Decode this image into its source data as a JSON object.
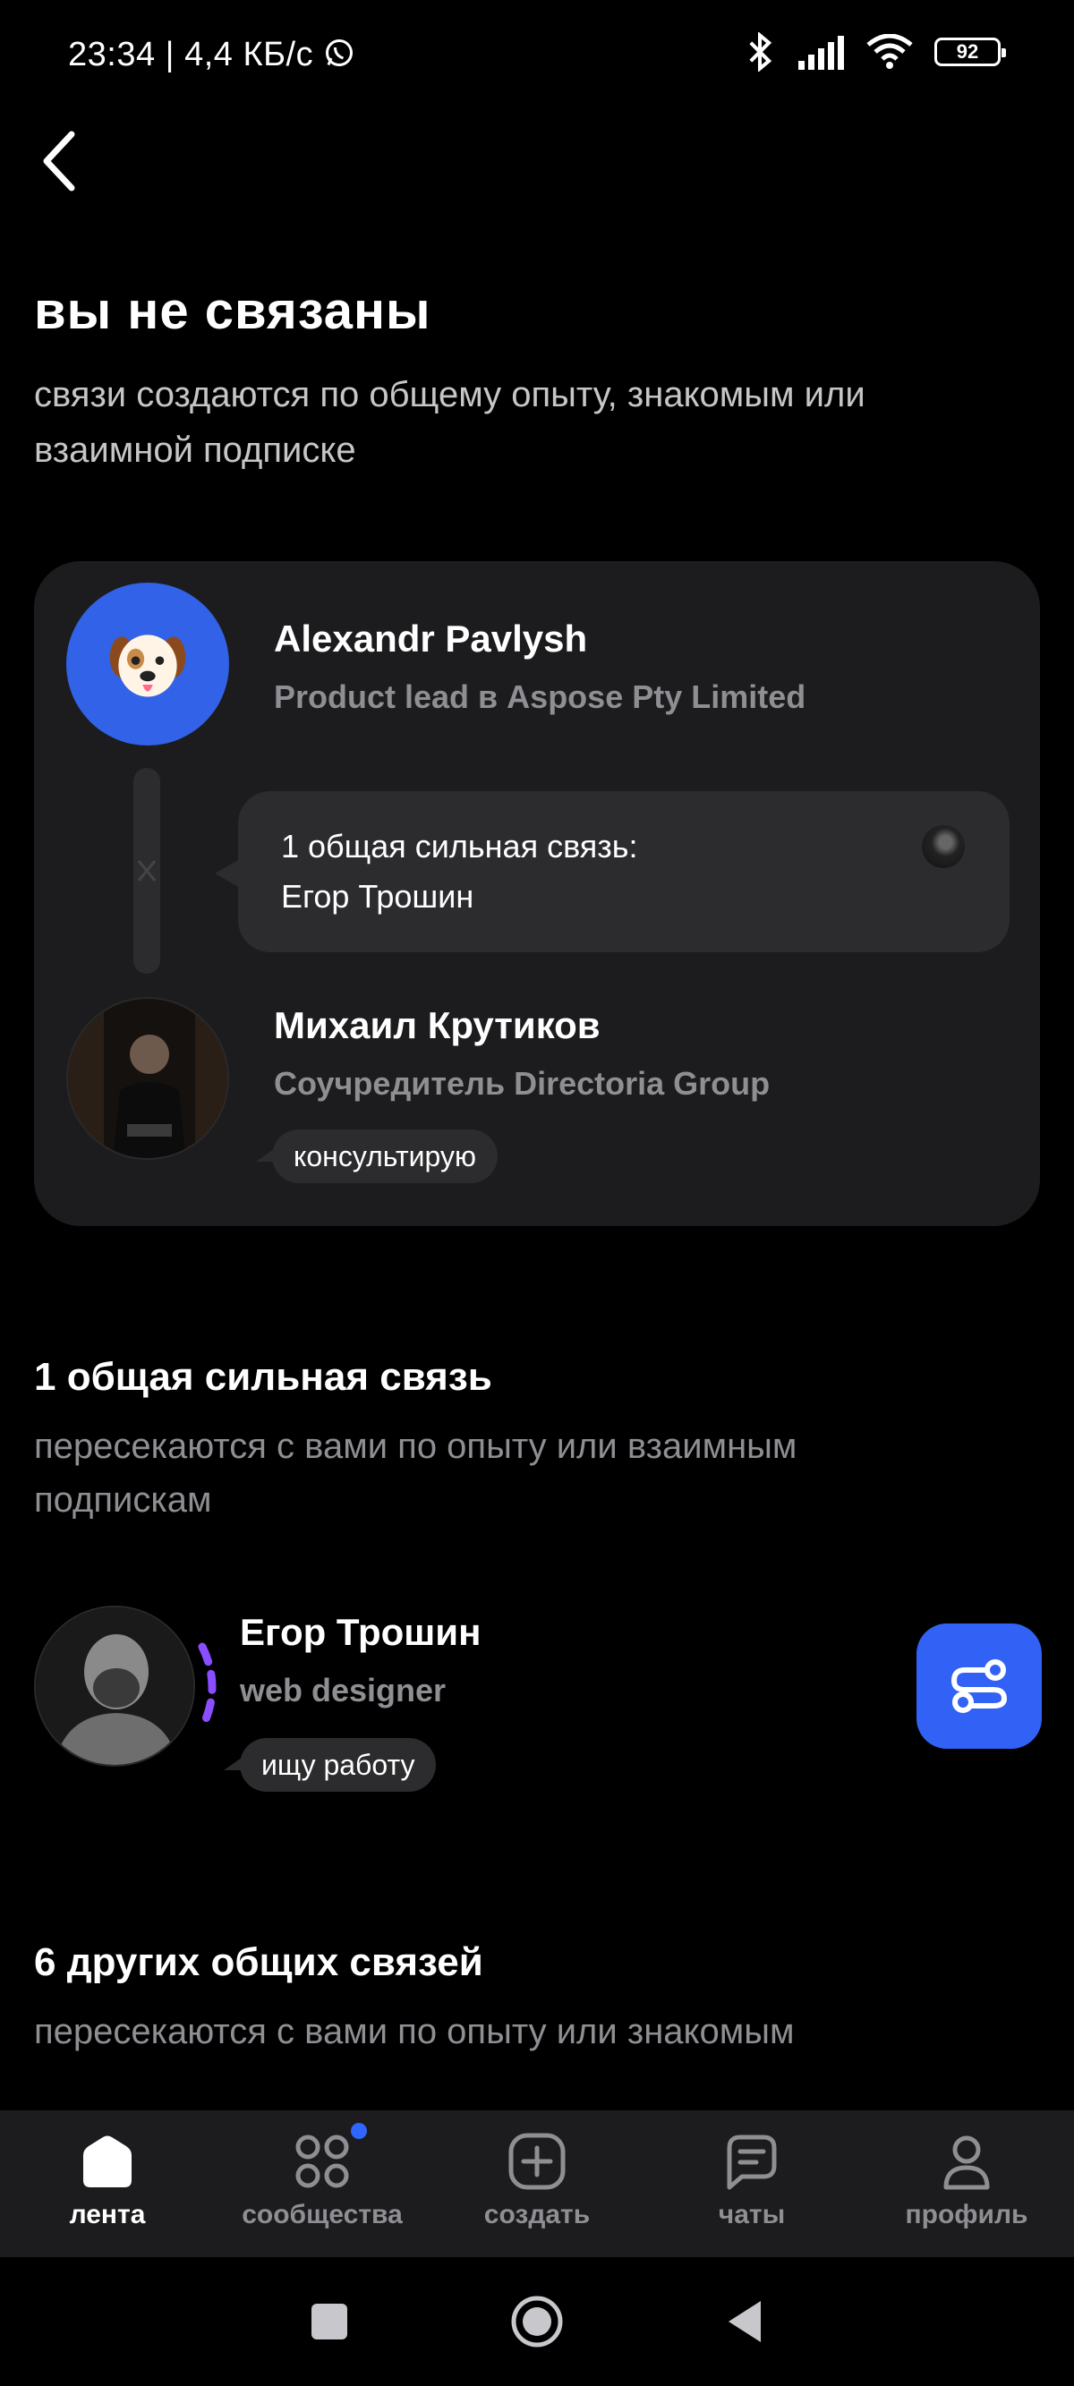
{
  "status_bar": {
    "time_speed": "23:34 | 4,4 КБ/с",
    "battery": "92"
  },
  "header": {
    "title": "вы не связаны",
    "subtitle": "связи создаются по общему опыту, знакомым или взаимной подписке"
  },
  "connection_card": {
    "person_a": {
      "name": "Alexandr Pavlysh",
      "role": "Product lead в Aspose Pty Limited"
    },
    "mutual": {
      "line1": "1 общая сильная связь:",
      "line2": "Егор Трошин"
    },
    "person_b": {
      "name": "Михаил Крутиков",
      "role": "Соучредитель Directoria Group",
      "tag": "консультирую"
    }
  },
  "strong_section": {
    "title": "1 общая сильная связь",
    "subtitle": "пересекаются с вами по опыту или взаимным подпискам",
    "people": [
      {
        "name": "Егор Трошин",
        "role": "web designer",
        "tag": "ищу работу"
      }
    ]
  },
  "other_section": {
    "title": "6 других общих связей",
    "subtitle": "пересекаются с вами по опыту или знакомым"
  },
  "bottom_nav": {
    "items": [
      {
        "label": "лента",
        "icon": "home-icon",
        "active": true
      },
      {
        "label": "сообщества",
        "icon": "grid-icon",
        "badge": true
      },
      {
        "label": "создать",
        "icon": "plus-square-icon"
      },
      {
        "label": "чаты",
        "icon": "chat-icon"
      },
      {
        "label": "профиль",
        "icon": "user-icon"
      }
    ]
  },
  "colors": {
    "background": "#000000",
    "card": "#1c1c1e",
    "accent": "#3162f5",
    "muted_text": "#8e8e93",
    "highlight_purple": "#8a4dff"
  }
}
